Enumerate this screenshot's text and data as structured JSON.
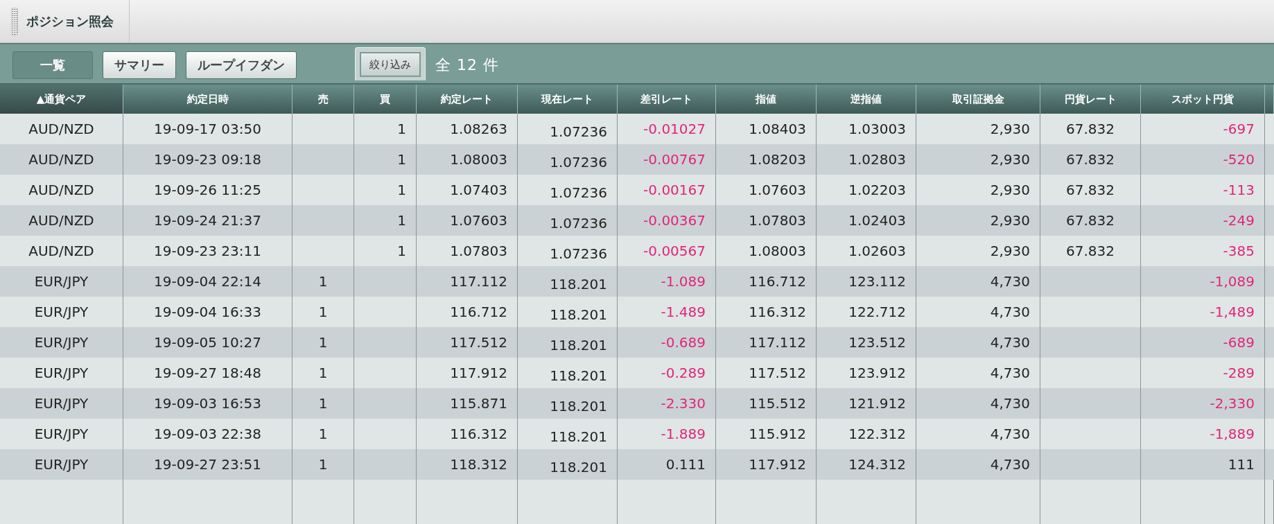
{
  "window": {
    "title": "ポジション照会"
  },
  "tabs": [
    {
      "label": "一覧",
      "selected": true
    },
    {
      "label": "サマリー",
      "selected": false
    },
    {
      "label": "ループイフダン",
      "selected": false
    }
  ],
  "filter_button": {
    "label": "絞り込み"
  },
  "count": "全 12 件",
  "table": {
    "columns": [
      {
        "label": "▲通貨ペア",
        "sorted": true
      },
      {
        "label": "約定日時",
        "sorted": false
      },
      {
        "label": "売",
        "sorted": false
      },
      {
        "label": "買",
        "sorted": false
      },
      {
        "label": "約定レート",
        "sorted": false
      },
      {
        "label": "現在レート",
        "sorted": false
      },
      {
        "label": "差引レート",
        "sorted": false
      },
      {
        "label": "指値",
        "sorted": false
      },
      {
        "label": "逆指値",
        "sorted": false
      },
      {
        "label": "取引証拠金",
        "sorted": false
      },
      {
        "label": "円貨レート",
        "sorted": false
      },
      {
        "label": "スポット円貨",
        "sorted": false
      }
    ],
    "rows": [
      {
        "loss": true,
        "cells": [
          "AUD/NZD",
          "19-09-17 03:50",
          "",
          "1",
          "1.08263",
          "1.07236",
          "-0.01027",
          "1.08403",
          "1.03003",
          "2,930",
          "67.832",
          "-697"
        ]
      },
      {
        "loss": true,
        "cells": [
          "AUD/NZD",
          "19-09-23 09:18",
          "",
          "1",
          "1.08003",
          "1.07236",
          "-0.00767",
          "1.08203",
          "1.02803",
          "2,930",
          "67.832",
          "-520"
        ]
      },
      {
        "loss": true,
        "cells": [
          "AUD/NZD",
          "19-09-26 11:25",
          "",
          "1",
          "1.07403",
          "1.07236",
          "-0.00167",
          "1.07603",
          "1.02203",
          "2,930",
          "67.832",
          "-113"
        ]
      },
      {
        "loss": true,
        "cells": [
          "AUD/NZD",
          "19-09-24 21:37",
          "",
          "1",
          "1.07603",
          "1.07236",
          "-0.00367",
          "1.07803",
          "1.02403",
          "2,930",
          "67.832",
          "-249"
        ]
      },
      {
        "loss": true,
        "cells": [
          "AUD/NZD",
          "19-09-23 23:11",
          "",
          "1",
          "1.07803",
          "1.07236",
          "-0.00567",
          "1.08003",
          "1.02603",
          "2,930",
          "67.832",
          "-385"
        ]
      },
      {
        "loss": true,
        "cells": [
          "EUR/JPY",
          "19-09-04 22:14",
          "1",
          "",
          "117.112",
          "118.201",
          "-1.089",
          "116.712",
          "123.112",
          "4,730",
          "",
          "-1,089"
        ]
      },
      {
        "loss": true,
        "cells": [
          "EUR/JPY",
          "19-09-04 16:33",
          "1",
          "",
          "116.712",
          "118.201",
          "-1.489",
          "116.312",
          "122.712",
          "4,730",
          "",
          "-1,489"
        ]
      },
      {
        "loss": true,
        "cells": [
          "EUR/JPY",
          "19-09-05 10:27",
          "1",
          "",
          "117.512",
          "118.201",
          "-0.689",
          "117.112",
          "123.512",
          "4,730",
          "",
          "-689"
        ]
      },
      {
        "loss": true,
        "cells": [
          "EUR/JPY",
          "19-09-27 18:48",
          "1",
          "",
          "117.912",
          "118.201",
          "-0.289",
          "117.512",
          "123.912",
          "4,730",
          "",
          "-289"
        ]
      },
      {
        "loss": true,
        "cells": [
          "EUR/JPY",
          "19-09-03 16:53",
          "1",
          "",
          "115.871",
          "118.201",
          "-2.330",
          "115.512",
          "121.912",
          "4,730",
          "",
          "-2,330"
        ]
      },
      {
        "loss": true,
        "cells": [
          "EUR/JPY",
          "19-09-03 22:38",
          "1",
          "",
          "116.312",
          "118.201",
          "-1.889",
          "115.912",
          "122.312",
          "4,730",
          "",
          "-1,889"
        ]
      },
      {
        "loss": false,
        "cells": [
          "EUR/JPY",
          "19-09-27 23:51",
          "1",
          "",
          "118.312",
          "118.201",
          "0.111",
          "117.912",
          "124.312",
          "4,730",
          "",
          "111"
        ]
      }
    ]
  }
}
